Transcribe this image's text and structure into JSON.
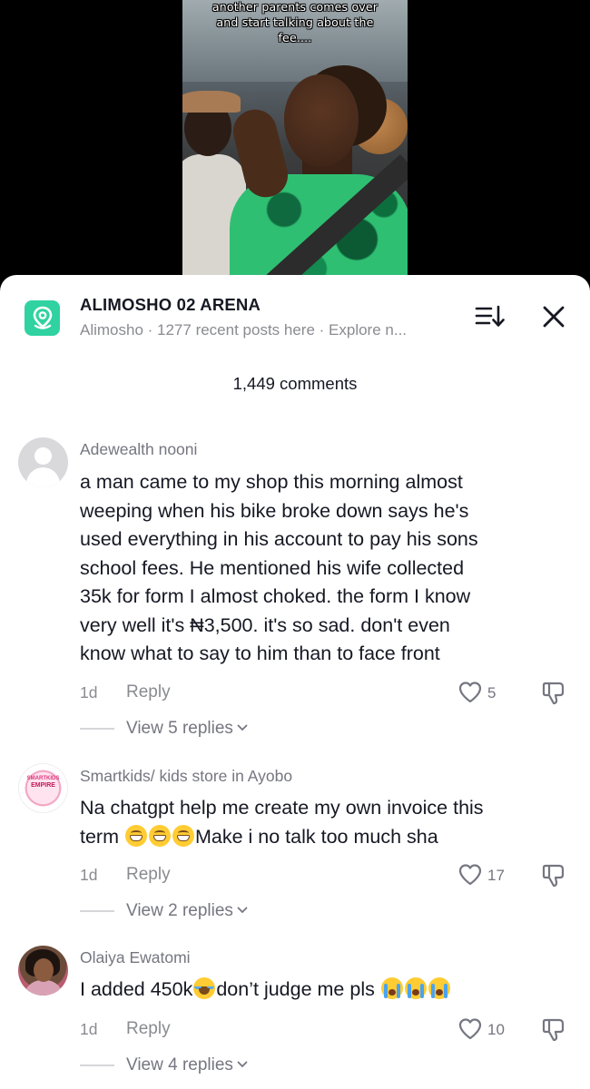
{
  "video": {
    "caption_lines": [
      "another parents comes over",
      "and start talking about the",
      "fee...."
    ]
  },
  "header": {
    "place_title": "ALIMOSHO 02 ARENA",
    "place_subtitle": "Alimosho · 1277 recent posts here · Explore n...",
    "icons": {
      "place": "map-pin-icon",
      "sort": "sort-icon",
      "close": "close-icon"
    }
  },
  "comments_count": "1,449 comments",
  "comments": [
    {
      "username": "Adewealth nooni",
      "lines": [
        "a man came to my shop this morning almost",
        "weeping when his bike broke down says he's",
        "used everything in his account to pay his sons",
        "school fees. He mentioned his wife collected",
        "35k for form I almost choked. the form I know",
        "very well it's ₦3,500. it's so sad. don't even",
        "know what to say to him than to face front"
      ],
      "time": "1d",
      "reply": "Reply",
      "likes": "5",
      "view_replies": "View 5 replies"
    },
    {
      "username": "Smartkids/ kids store in Ayobo",
      "avatar_text": [
        "SMARTKIDS",
        "EMPIRE"
      ],
      "line1": "Na chatgpt help me create my own invoice this",
      "line2_prefix": "term ",
      "line2_suffix": "Make i no talk too much sha",
      "time": "1d",
      "reply": "Reply",
      "likes": "17",
      "view_replies": "View 2 replies"
    },
    {
      "username": "Olaiya Ewatomi",
      "text_prefix": "I added 450k",
      "text_suffix": "don’t judge me pls ",
      "time": "1d",
      "reply": "Reply",
      "likes": "10",
      "view_replies": "View 4 replies"
    }
  ],
  "colors": {
    "accent_place": "#2fd2a0",
    "text_primary": "#161823",
    "text_secondary": "#8a8b91"
  }
}
